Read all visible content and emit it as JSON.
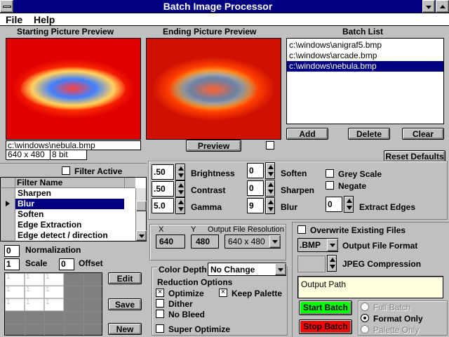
{
  "window": {
    "title": "Batch Image Processor",
    "menu": [
      "File",
      "Help"
    ]
  },
  "preview": {
    "start_label": "Starting Picture Preview",
    "end_label": "Ending Picture Preview",
    "filename": "c:\\windows\\nebula.bmp",
    "size": "640 x 480",
    "depth": "8 bit",
    "preview_button": "Preview"
  },
  "batch": {
    "label": "Batch List",
    "items": [
      "c:\\windows\\anigraf5.bmp",
      "c:\\windows\\arcade.bmp",
      "c:\\windows\\nebula.bmp"
    ],
    "add": "Add",
    "delete": "Delete",
    "clear": "Clear",
    "reset": "Reset Defaults"
  },
  "adjust": {
    "brightness_val": ".50",
    "brightness": "Brightness",
    "contrast_val": ".50",
    "contrast": "Contrast",
    "gamma_val": "5.0",
    "gamma": "Gamma",
    "soften_val": "0",
    "soften": "Soften",
    "sharpen_val": "0",
    "sharpen": "Sharpen",
    "blur_val": "9",
    "blur": "Blur",
    "grey": "Grey Scale",
    "negate": "Negate",
    "edges_val": "0",
    "edges": "Extract Edges"
  },
  "filters": {
    "active_label": "Filter Active",
    "header": "Filter Name",
    "items": [
      "Sharpen",
      "Blur",
      "Soften",
      "Edge Extraction",
      "Edge detect / direction"
    ],
    "normalization_val": "0",
    "normalization": "Normalization",
    "scale_val": "1",
    "scale": "Scale",
    "offset_val": "0",
    "offset": "Offset",
    "matrix": [
      [
        "1",
        "1",
        "1"
      ],
      [
        "1",
        "1",
        "1"
      ],
      [
        "1",
        "1",
        "1"
      ]
    ],
    "edit": "Edit",
    "save": "Save",
    "new": "New"
  },
  "resolution": {
    "x_label": "X",
    "y_label": "Y",
    "title": "Output File Resolution",
    "x": "640",
    "y": "480",
    "preset": "640 x 480"
  },
  "color": {
    "depth_label": "Color Depth",
    "depth": "No Change",
    "reduction": "Reduction Options",
    "optimize": "Optimize",
    "keep": "Keep Palette",
    "dither": "Dither",
    "nobleed": "No Bleed",
    "super": "Super Optimize"
  },
  "output": {
    "overwrite": "Overwrite Existing Files",
    "format": ".BMP",
    "format_label": "Output File Format",
    "jpeg_label": "JPEG Compression",
    "path": "Output Path",
    "start": "Start Batch",
    "stop": "Stop Batch",
    "full": "Full Batch",
    "format_only": "Format Only",
    "palette_only": "Palette Only"
  },
  "colors": {
    "title_bar": "#000080",
    "start": "#00ff00",
    "stop": "#ff0000",
    "path_bg": "#ffffe0"
  }
}
